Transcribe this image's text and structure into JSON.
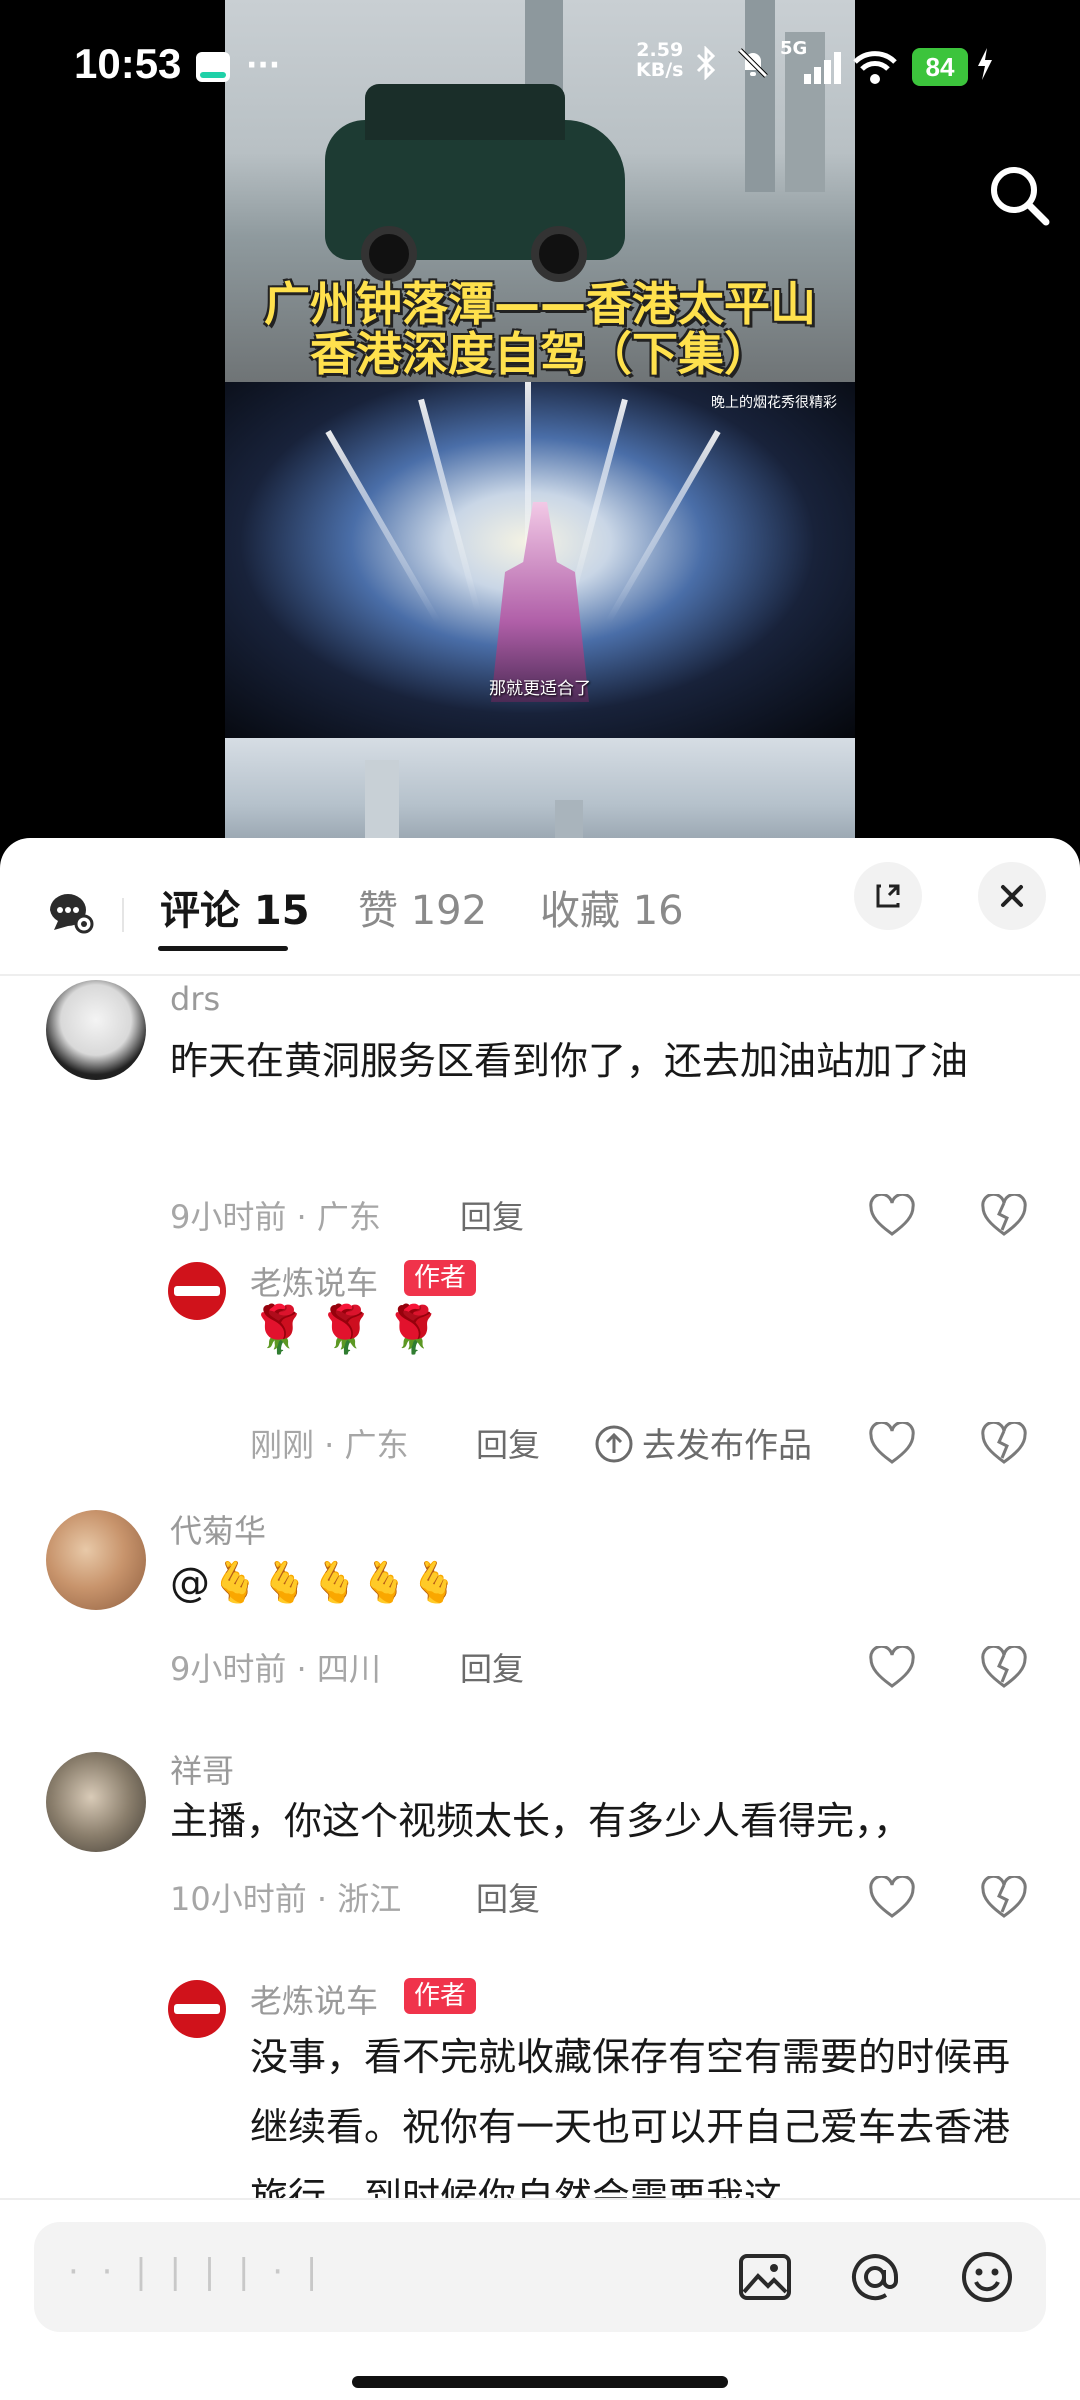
{
  "status_bar": {
    "time": "10:53",
    "more": "···",
    "net_speed_value": "2.59",
    "net_speed_unit": "KB/s",
    "signal_label": "5G",
    "battery": "84"
  },
  "video": {
    "cover_title_line1": "广州钟落潭——香港太平山",
    "cover_title_line2": "香港深度自驾（下集）",
    "frame_tag": "晚上的烟花秀很精彩",
    "frame_subtitle": "那就更适合了",
    "search_icon": "search-icon"
  },
  "tabs": [
    {
      "label": "评论 15",
      "active": true
    },
    {
      "label": "赞 192",
      "active": false
    },
    {
      "label": "收藏 16",
      "active": false
    }
  ],
  "comments": [
    {
      "user": "drs",
      "text": "昨天在黄洞服务区看到你了，还去加油站加了油",
      "time_loc": "9小时前 · 广东",
      "reply_label": "回复",
      "replies": [
        {
          "user": "老炼说车",
          "author_tag": "作者",
          "emojis": "🌹🌹🌹",
          "time_loc": "刚刚 · 广东",
          "reply_label": "回复",
          "publish_label": "去发布作品"
        }
      ]
    },
    {
      "user": "代菊华",
      "text": "@🫰🫰🫰🫰🫰",
      "time_loc": "9小时前 · 四川",
      "reply_label": "回复"
    },
    {
      "user": "祥哥",
      "text": "主播，你这个视频太长，有多少人看得完，，",
      "time_loc": "10小时前 · 浙江",
      "reply_label": "回复",
      "replies": [
        {
          "user": "老炼说车",
          "author_tag": "作者",
          "text": "没事，看不完就收藏保存有空有需要的时候再继续看。祝你有一天也可以开自己爱车去香港旅行，到时候你自然会需要我这"
        }
      ]
    }
  ],
  "input_bar": {
    "placeholder": "· · | | | | · |",
    "icons": [
      "image-icon",
      "at-icon",
      "emoji-icon"
    ]
  },
  "colors": {
    "author_tag": "#f0334b",
    "battery": "#3cc43c",
    "avatar_author": "#d0121b"
  }
}
